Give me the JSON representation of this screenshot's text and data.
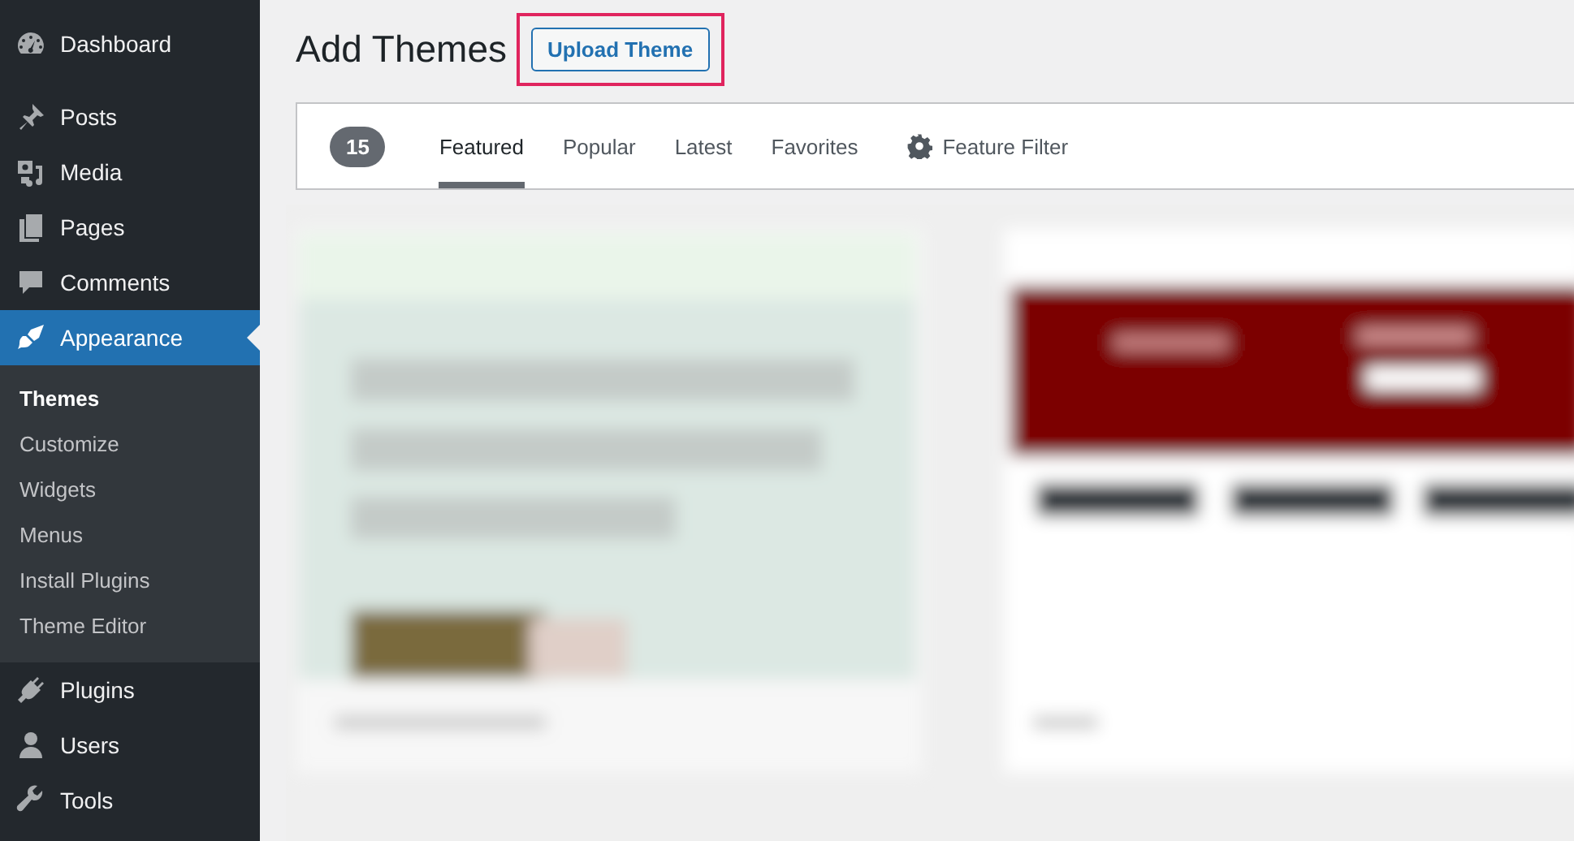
{
  "sidebar": {
    "items": [
      {
        "label": "Dashboard",
        "selected": false
      },
      {
        "label": "Posts",
        "selected": false
      },
      {
        "label": "Media",
        "selected": false
      },
      {
        "label": "Pages",
        "selected": false
      },
      {
        "label": "Comments",
        "selected": false
      },
      {
        "label": "Appearance",
        "selected": true,
        "children": [
          {
            "label": "Themes",
            "selected": true
          },
          {
            "label": "Customize",
            "selected": false
          },
          {
            "label": "Widgets",
            "selected": false
          },
          {
            "label": "Menus",
            "selected": false
          },
          {
            "label": "Install Plugins",
            "selected": false
          },
          {
            "label": "Theme Editor",
            "selected": false
          }
        ]
      },
      {
        "label": "Plugins",
        "selected": false
      },
      {
        "label": "Users",
        "selected": false
      },
      {
        "label": "Tools",
        "selected": false
      }
    ]
  },
  "page": {
    "title": "Add Themes",
    "upload_button": {
      "label": "Upload Theme",
      "highlighted": true
    }
  },
  "filter_bar": {
    "count": "15",
    "tabs": [
      {
        "label": "Featured",
        "selected": true
      },
      {
        "label": "Popular",
        "selected": false
      },
      {
        "label": "Latest",
        "selected": false
      },
      {
        "label": "Favorites",
        "selected": false
      }
    ],
    "feature_filter": "Feature Filter"
  }
}
